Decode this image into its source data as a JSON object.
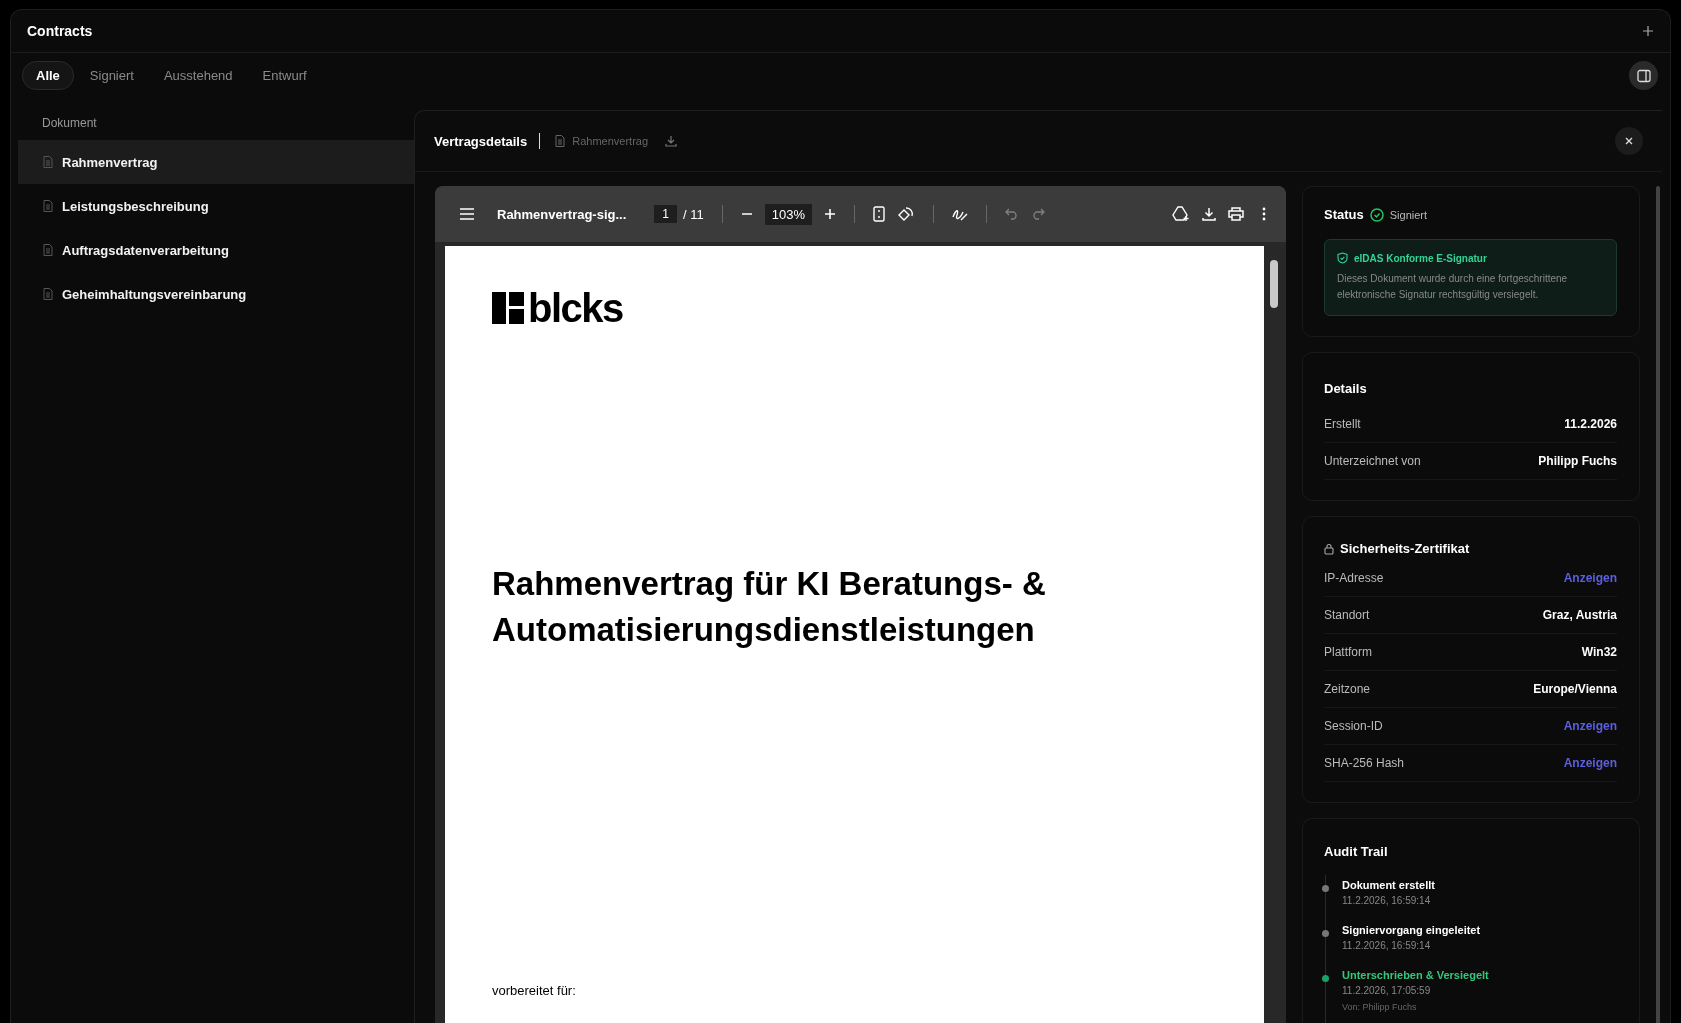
{
  "app": {
    "title": "Contracts"
  },
  "tabs": [
    {
      "label": "Alle",
      "selected": true
    },
    {
      "label": "Signiert",
      "selected": false
    },
    {
      "label": "Ausstehend",
      "selected": false
    },
    {
      "label": "Entwurf",
      "selected": false
    }
  ],
  "list": {
    "column": "Dokument",
    "items": [
      {
        "name": "Rahmenvertrag",
        "selected": true
      },
      {
        "name": "Leistungsbeschreibung",
        "selected": false
      },
      {
        "name": "Auftragsdatenverarbeitung",
        "selected": false
      },
      {
        "name": "Geheimhaltungsvereinbarung",
        "selected": false
      }
    ]
  },
  "detail": {
    "title": "Vertragsdetails",
    "file": "Rahmenvertrag"
  },
  "viewer": {
    "file": "Rahmenvertrag-sig...",
    "page": "1",
    "pages": "/ 11",
    "zoom": "103%",
    "undo": {
      "disabled": true
    },
    "redo": {
      "disabled": true
    },
    "document": {
      "logo": "blcks",
      "title": "Rahmenvertrag für KI Beratungs- & Automatisierungsdienstleistungen",
      "footer": "vorbereitet für:"
    }
  },
  "status": {
    "heading": "Status",
    "value": "Signiert",
    "notice": {
      "title": "eIDAS Konforme E-Signatur",
      "text": "Dieses Dokument wurde durch eine fortgeschrittene elektronische Signatur rechtsgültig versiegelt."
    }
  },
  "details": {
    "heading": "Details",
    "rows": [
      {
        "label": "Erstellt",
        "value": "11.2.2026"
      },
      {
        "label": "Unterzeichnet von",
        "value": "Philipp Fuchs"
      }
    ]
  },
  "certificate": {
    "heading": "Sicherheits-Zertifikat",
    "rows": [
      {
        "label": "IP-Adresse",
        "value": "Anzeigen",
        "kind": "link"
      },
      {
        "label": "Standort",
        "value": "Graz, Austria",
        "kind": "text"
      },
      {
        "label": "Plattform",
        "value": "Win32",
        "kind": "text"
      },
      {
        "label": "Zeitzone",
        "value": "Europe/Vienna",
        "kind": "text"
      },
      {
        "label": "Session-ID",
        "value": "Anzeigen",
        "kind": "link"
      },
      {
        "label": "SHA-256 Hash",
        "value": "Anzeigen",
        "kind": "link"
      }
    ]
  },
  "audit": {
    "heading": "Audit Trail",
    "events": [
      {
        "title": "Dokument erstellt",
        "time": "11.2.2026, 16:59:14",
        "kind": "step"
      },
      {
        "title": "Signiervorgang eingeleitet",
        "time": "11.2.2026, 16:59:14",
        "kind": "step"
      },
      {
        "title": "Unterschrieben & Versiegelt",
        "time": "11.2.2026, 17:05:59",
        "by": "Von: Philipp Fuchs",
        "kind": "final"
      }
    ]
  }
}
